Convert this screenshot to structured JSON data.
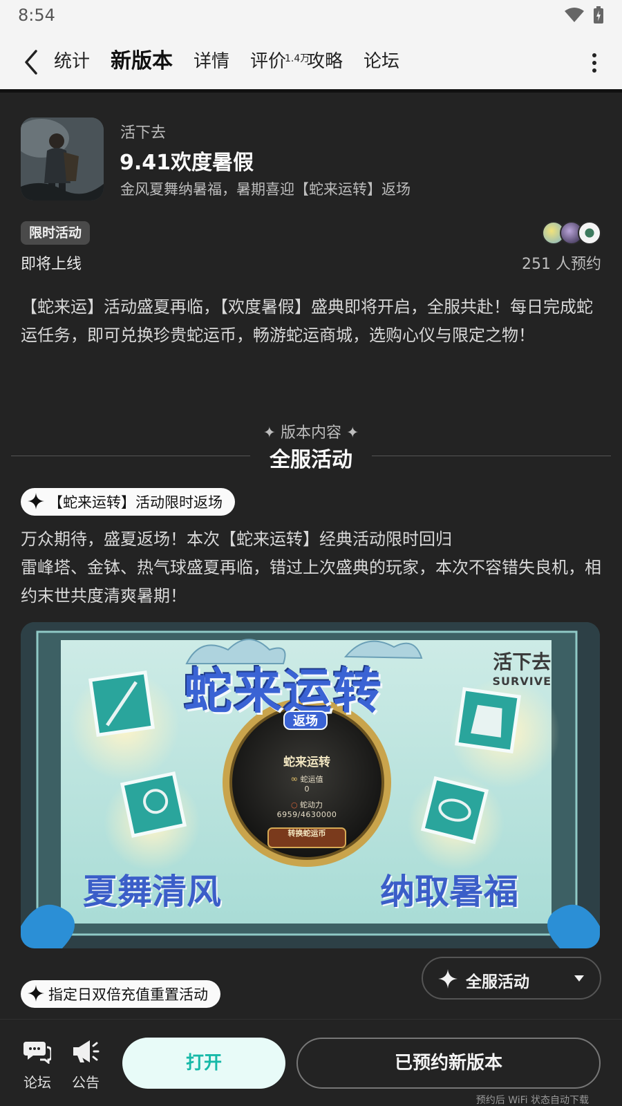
{
  "status_bar": {
    "time": "8:54"
  },
  "nav": {
    "tabs": [
      {
        "label": "统计"
      },
      {
        "label": "新版本"
      },
      {
        "label": "详情"
      },
      {
        "label": "评价",
        "badge": "1.4万"
      },
      {
        "label": "攻略"
      },
      {
        "label": "论坛"
      }
    ],
    "active_tab": "新版本",
    "accent_color": "#18c8b8"
  },
  "game": {
    "name": "活下去",
    "version_title": "9.41欢度暑假",
    "version_subtitle": "金风夏舞纳暑福，暑期喜迎【蛇来运转】返场"
  },
  "event": {
    "badge": "限时活动",
    "status": "即将上线",
    "reserve_count": "251 人预约"
  },
  "intro_text": "【蛇来运】活动盛夏再临，【欢度暑假】盛典即将开启，全服共赴！每日完成蛇运任务，即可兑换珍贵蛇运币，畅游蛇运商城，选购心仪与限定之物！",
  "section": {
    "kicker": "✦ 版本内容 ✦",
    "title": "全服活动"
  },
  "activity1": {
    "tag": "【蛇来运转】活动限时返场",
    "desc_line1": "万众期待，盛夏返场！本次【蛇来运转】经典活动限时回归",
    "desc_line2": "雷峰塔、金钵、热气球盛夏再临，错过上次盛典的玩家，本次不容错失良机，相约末世共度清爽暑期！"
  },
  "banner": {
    "title": "蛇来运转",
    "ribbon": "返场",
    "logo_cn": "活下去",
    "logo_en": "SURVIVE",
    "left_slogan": "夏舞清风",
    "right_slogan": "纳取暑福",
    "wheel_title": "蛇来运转",
    "wheel_value_label": "蛇运值",
    "wheel_value": "0",
    "wheel_power_label": "蛇动力",
    "wheel_power": "6959/4630000",
    "wheel_button": "转换蛇运币"
  },
  "activity2": {
    "tag": "指定日双倍充值重置活动"
  },
  "filter": {
    "label": "全服活动"
  },
  "bottom": {
    "forum_label": "论坛",
    "notice_label": "公告",
    "open_label": "打开",
    "reserved_label": "已预约新版本",
    "footnote": "预约后 WiFi 状态自动下载"
  }
}
